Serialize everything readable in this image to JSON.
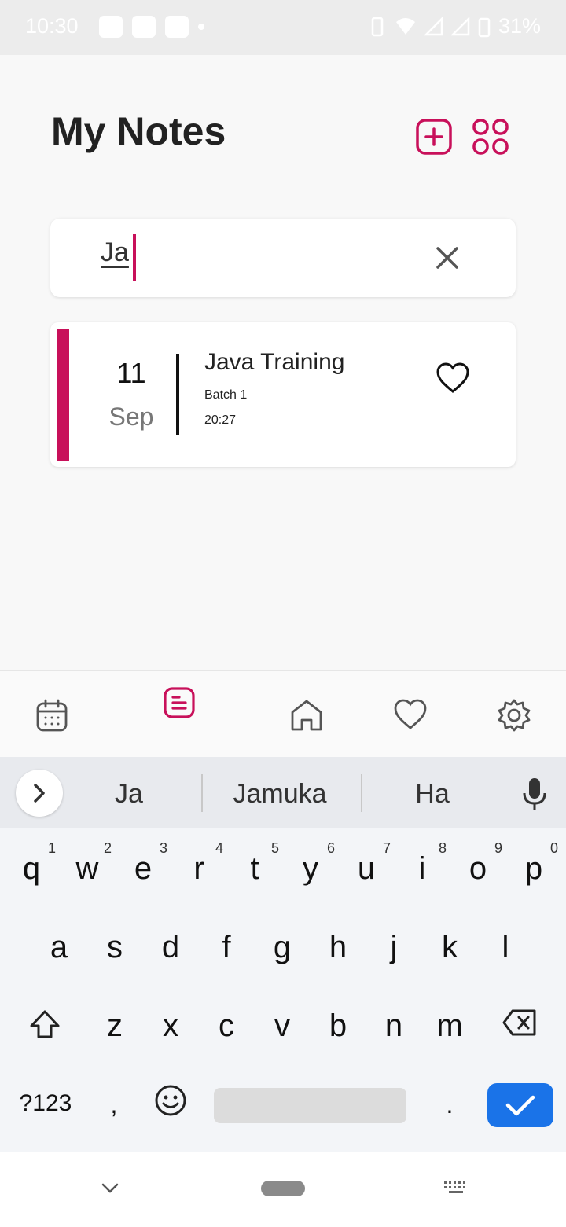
{
  "status_bar": {
    "time": "10:30",
    "battery": "31%"
  },
  "header": {
    "title": "My Notes"
  },
  "search": {
    "value": "Ja"
  },
  "notes": [
    {
      "day": "11",
      "month": "Sep",
      "title": "Java Training",
      "subtitle": "Batch 1",
      "time": "20:27"
    }
  ],
  "keyboard": {
    "suggestions": [
      "Ja",
      "Jamuka",
      "Ha"
    ],
    "row1": [
      [
        "q",
        "1"
      ],
      [
        "w",
        "2"
      ],
      [
        "e",
        "3"
      ],
      [
        "r",
        "4"
      ],
      [
        "t",
        "5"
      ],
      [
        "y",
        "6"
      ],
      [
        "u",
        "7"
      ],
      [
        "i",
        "8"
      ],
      [
        "o",
        "9"
      ],
      [
        "p",
        "0"
      ]
    ],
    "row2": [
      "a",
      "s",
      "d",
      "f",
      "g",
      "h",
      "j",
      "k",
      "l"
    ],
    "row3": [
      "z",
      "x",
      "c",
      "v",
      "b",
      "n",
      "m"
    ],
    "row4": {
      "symbols": "?123",
      "comma": ",",
      "period": "."
    }
  },
  "colors": {
    "accent": "#c8105a",
    "enter": "#1a73e8"
  }
}
